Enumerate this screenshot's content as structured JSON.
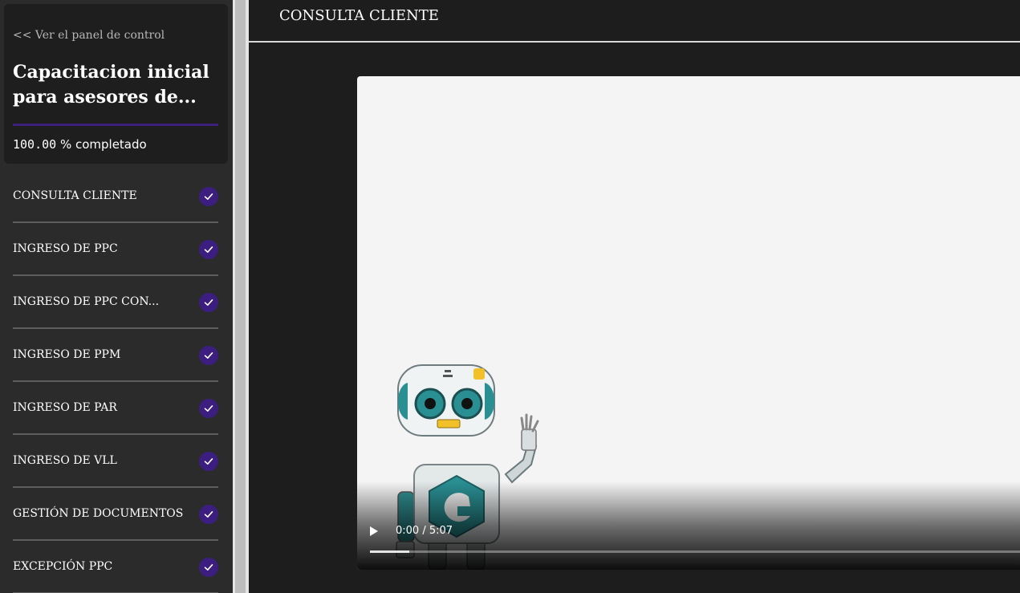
{
  "sidebar": {
    "back_link": "<< Ver el panel de control",
    "course_title_line1": "Capacitacion inicial",
    "course_title_line2": "para asesores de...",
    "progress_value": "100.00",
    "progress_suffix": " % completado",
    "progress_fraction": 1.0,
    "lessons": [
      {
        "label": "CONSULTA CLIENTE",
        "completed": true
      },
      {
        "label": "INGRESO DE PPC",
        "completed": true
      },
      {
        "label": "INGRESO DE PPC CON...",
        "completed": true
      },
      {
        "label": "INGRESO DE PPM",
        "completed": true
      },
      {
        "label": "INGRESO DE PAR",
        "completed": true
      },
      {
        "label": "INGRESO DE VLL",
        "completed": true
      },
      {
        "label": "GESTIÓN DE DOCUMENTOS",
        "completed": true
      },
      {
        "label": "EXCEPCIÓN PPC",
        "completed": true
      }
    ]
  },
  "header": {
    "title": "CONSULTA CLIENTE"
  },
  "video": {
    "time_display": "0:00 / 5:07",
    "played_fraction": 0.06
  },
  "icons": {
    "lesson_status": "checkmark-icon",
    "play": "play-icon",
    "mascot": "robot-mascot"
  },
  "colors": {
    "accent": "#3b1e80",
    "sidebar_bg": "#2b2b2b",
    "main_bg": "#1d1d1d",
    "video_bg": "#f4f4f4"
  }
}
